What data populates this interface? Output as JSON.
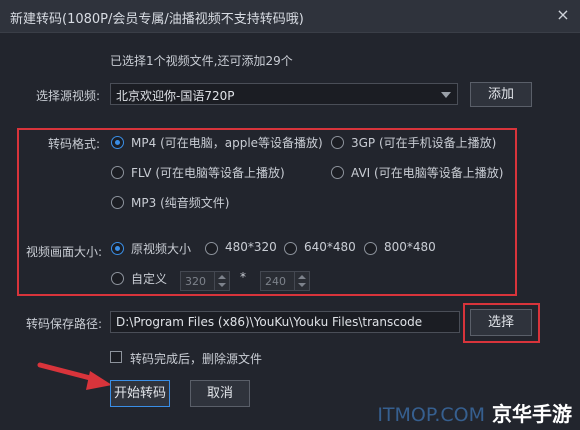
{
  "window": {
    "title": "新建转码(1080P/会员专属/油播视频不支持转码哦)",
    "close_symbol": "×"
  },
  "info": "已选择1个视频文件,还可添加29个",
  "source": {
    "label": "选择源视频:",
    "value": "北京欢迎你-国语720P",
    "add_button": "添加"
  },
  "format": {
    "label": "转码格式:",
    "options": [
      {
        "name": "MP4",
        "desc": "(可在电脑，apple等设备播放)",
        "checked": true
      },
      {
        "name": "3GP",
        "desc": "(可在手机设备上播放)",
        "checked": false
      },
      {
        "name": "FLV",
        "desc": "(可在电脑等设备上播放)",
        "checked": false
      },
      {
        "name": "AVI",
        "desc": "(可在电脑等设备上播放)",
        "checked": false
      },
      {
        "name": "MP3",
        "desc": "(纯音频文件)",
        "checked": false
      }
    ]
  },
  "size": {
    "label": "视频画面大小:",
    "options": [
      {
        "name": "原视频大小",
        "checked": true
      },
      {
        "name": "480*320",
        "checked": false
      },
      {
        "name": "640*480",
        "checked": false
      },
      {
        "name": "800*480",
        "checked": false
      },
      {
        "name": "自定义",
        "checked": false
      }
    ],
    "custom_width": "320",
    "custom_separator": "*",
    "custom_height": "240"
  },
  "save": {
    "label": "转码保存路径:",
    "path": "D:\\Program Files (x86)\\YouKu\\Youku Files\\transcode",
    "choose_button": "选择"
  },
  "delete_source": {
    "label": "转码完成后，删除源文件",
    "checked": false
  },
  "actions": {
    "start": "开始转码",
    "cancel": "取消"
  },
  "watermark": {
    "itmop": "ITMOP.COM",
    "brand": "京华手游"
  },
  "colors": {
    "accent": "#3a8ee6",
    "highlight": "#d8343b",
    "background": "#22252d"
  }
}
